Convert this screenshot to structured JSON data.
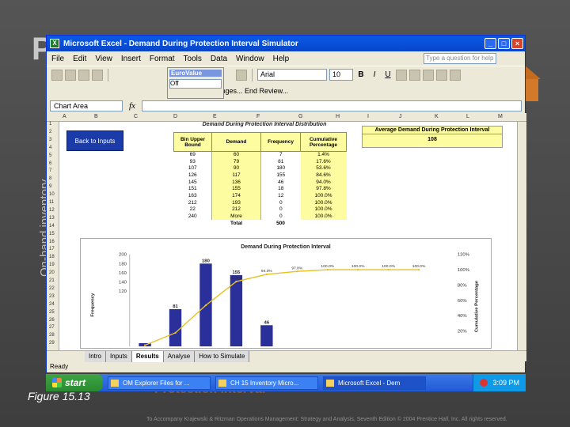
{
  "slide": {
    "title_fragment": "P",
    "vertical_label": "On-hand inventory",
    "figure_caption": "Figure 15.13",
    "background_subtitle": "Protection interval",
    "footer": "To Accompany Krajewski & Ritzman Operations Management: Strategy and Analysis, Seventh Edition © 2004 Prentice Hall, Inc. All rights reserved."
  },
  "window": {
    "title": "Microsoft Excel - Demand During Protection Interval Simulator",
    "menu": [
      "File",
      "Edit",
      "View",
      "Insert",
      "Format",
      "Tools",
      "Data",
      "Window",
      "Help"
    ],
    "ask_placeholder": "Type a question for help",
    "font_name": "Arial",
    "font_size": "10",
    "eurovalue_label": "EuroValue",
    "eurovalue_select": "Off",
    "reply_label": "Reply with Changes... End Review...",
    "name_box": "Chart Area",
    "fx": "fx"
  },
  "sheet": {
    "columns": [
      "A",
      "B",
      "C",
      "D",
      "E",
      "F",
      "G",
      "H",
      "I",
      "J",
      "K",
      "L",
      "M"
    ],
    "rows": [
      "1",
      "2",
      "3",
      "4",
      "5",
      "6",
      "7",
      "8",
      "9",
      "10",
      "11",
      "12",
      "13",
      "14",
      "15",
      "16",
      "17",
      "18",
      "19",
      "20",
      "21",
      "22",
      "23",
      "24",
      "25",
      "26",
      "27",
      "28",
      "29"
    ],
    "back_button": "Back to Inputs",
    "table_title": "Demand During Protection Interval Distribution",
    "avg_label": "Average Demand During Protection Interval",
    "avg_value": "108",
    "headers": [
      "Bin Upper Bound",
      "Demand",
      "Frequency",
      "Cumulative Percentage"
    ],
    "data_rows": [
      [
        "69",
        "60",
        "7",
        "1.4%"
      ],
      [
        "93",
        "79",
        "81",
        "17.6%"
      ],
      [
        "107",
        "90",
        "180",
        "53.6%"
      ],
      [
        "126",
        "117",
        "155",
        "84.6%"
      ],
      [
        "145",
        "136",
        "46",
        "94.0%"
      ],
      [
        "151",
        "155",
        "18",
        "97.8%"
      ],
      [
        "163",
        "174",
        "12",
        "100.0%"
      ],
      [
        "212",
        "193",
        "0",
        "100.0%"
      ],
      [
        "22",
        "212",
        "0",
        "100.0%"
      ],
      [
        "240",
        "More",
        "0",
        "100.0%"
      ]
    ],
    "total_label": "Total",
    "total_value": "500"
  },
  "chart_data": {
    "type": "bar",
    "title": "Demand During Protection Interval",
    "ylabel": "Frequency",
    "y2label": "Cumulative Percentage",
    "ylim": [
      0,
      200
    ],
    "y_ticks": [
      "200",
      "180",
      "160",
      "140",
      "120"
    ],
    "y2_ticks": [
      "120%",
      "100%",
      "80%",
      "60%",
      "40%",
      "20%"
    ],
    "bar_values": [
      7,
      81,
      180,
      155,
      46
    ],
    "bar_labels": [
      "",
      "81",
      "180",
      "155",
      "46"
    ],
    "line_values": [
      1.4,
      17.6,
      53.6,
      84.6,
      94.0,
      97.8,
      100.0,
      100.0,
      100.0,
      100.0
    ],
    "line_labels": [
      "",
      "",
      "",
      "84.6%",
      "94.0%",
      "97.8%",
      "100.0%",
      "100.0%",
      "100.0%",
      "100.0%"
    ]
  },
  "tabs": [
    "Intro",
    "Inputs",
    "Results",
    "Analyse",
    "How to Simulate"
  ],
  "active_tab": "Results",
  "status": "Ready",
  "taskbar": {
    "start": "start",
    "tasks": [
      "OM Explorer Files for ...",
      "CH 15 Inventory Micro...",
      "Microsoft Excel - Dem"
    ],
    "clock": "3:09 PM"
  },
  "colors": {
    "bar": "#2a2f9a",
    "line": "#e8c020",
    "table_fill": "#fdfca0",
    "title_bar": "#0a5ae8",
    "back_button": "#1a3ba8"
  }
}
